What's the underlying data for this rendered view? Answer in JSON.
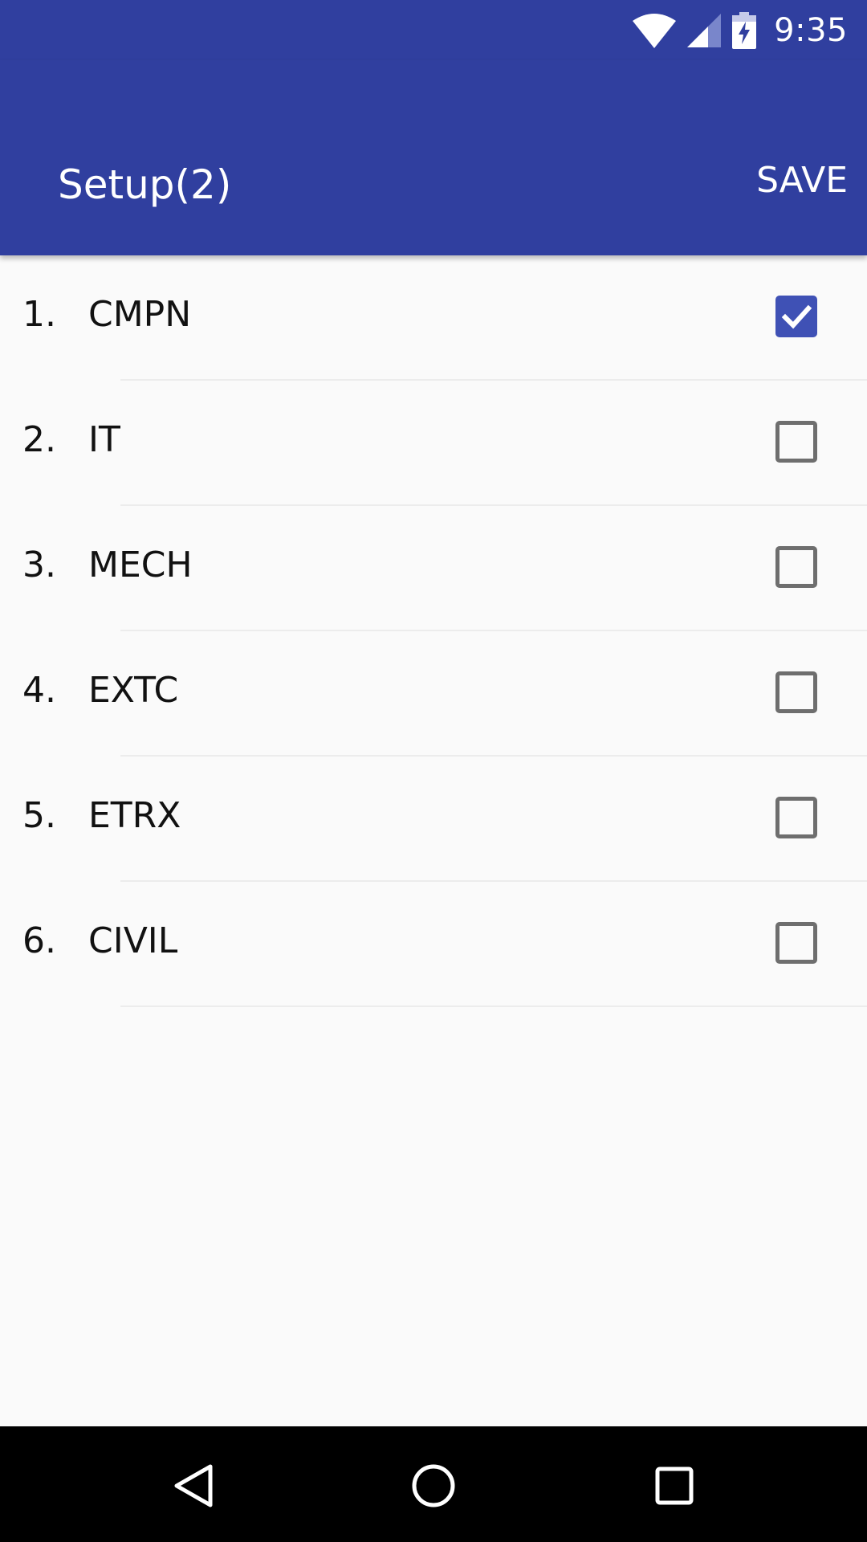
{
  "status_bar": {
    "time": "9:35",
    "icons": [
      "wifi-icon",
      "cell-signal-icon",
      "battery-charging-icon"
    ]
  },
  "toolbar": {
    "title": "Setup(2)",
    "save_label": "SAVE"
  },
  "colors": {
    "primary": "#303F9F",
    "accent": "#3F51B5",
    "background": "#FAFAFA"
  },
  "list": {
    "items": [
      {
        "number": "1.",
        "label": "CMPN",
        "checked": true
      },
      {
        "number": "2.",
        "label": "IT",
        "checked": false
      },
      {
        "number": "3.",
        "label": "MECH",
        "checked": false
      },
      {
        "number": "4.",
        "label": "EXTC",
        "checked": false
      },
      {
        "number": "5.",
        "label": "ETRX",
        "checked": false
      },
      {
        "number": "6.",
        "label": "CIVIL",
        "checked": false
      }
    ]
  },
  "nav_bar": {
    "icons": [
      "back-icon",
      "home-icon",
      "recents-icon"
    ]
  }
}
